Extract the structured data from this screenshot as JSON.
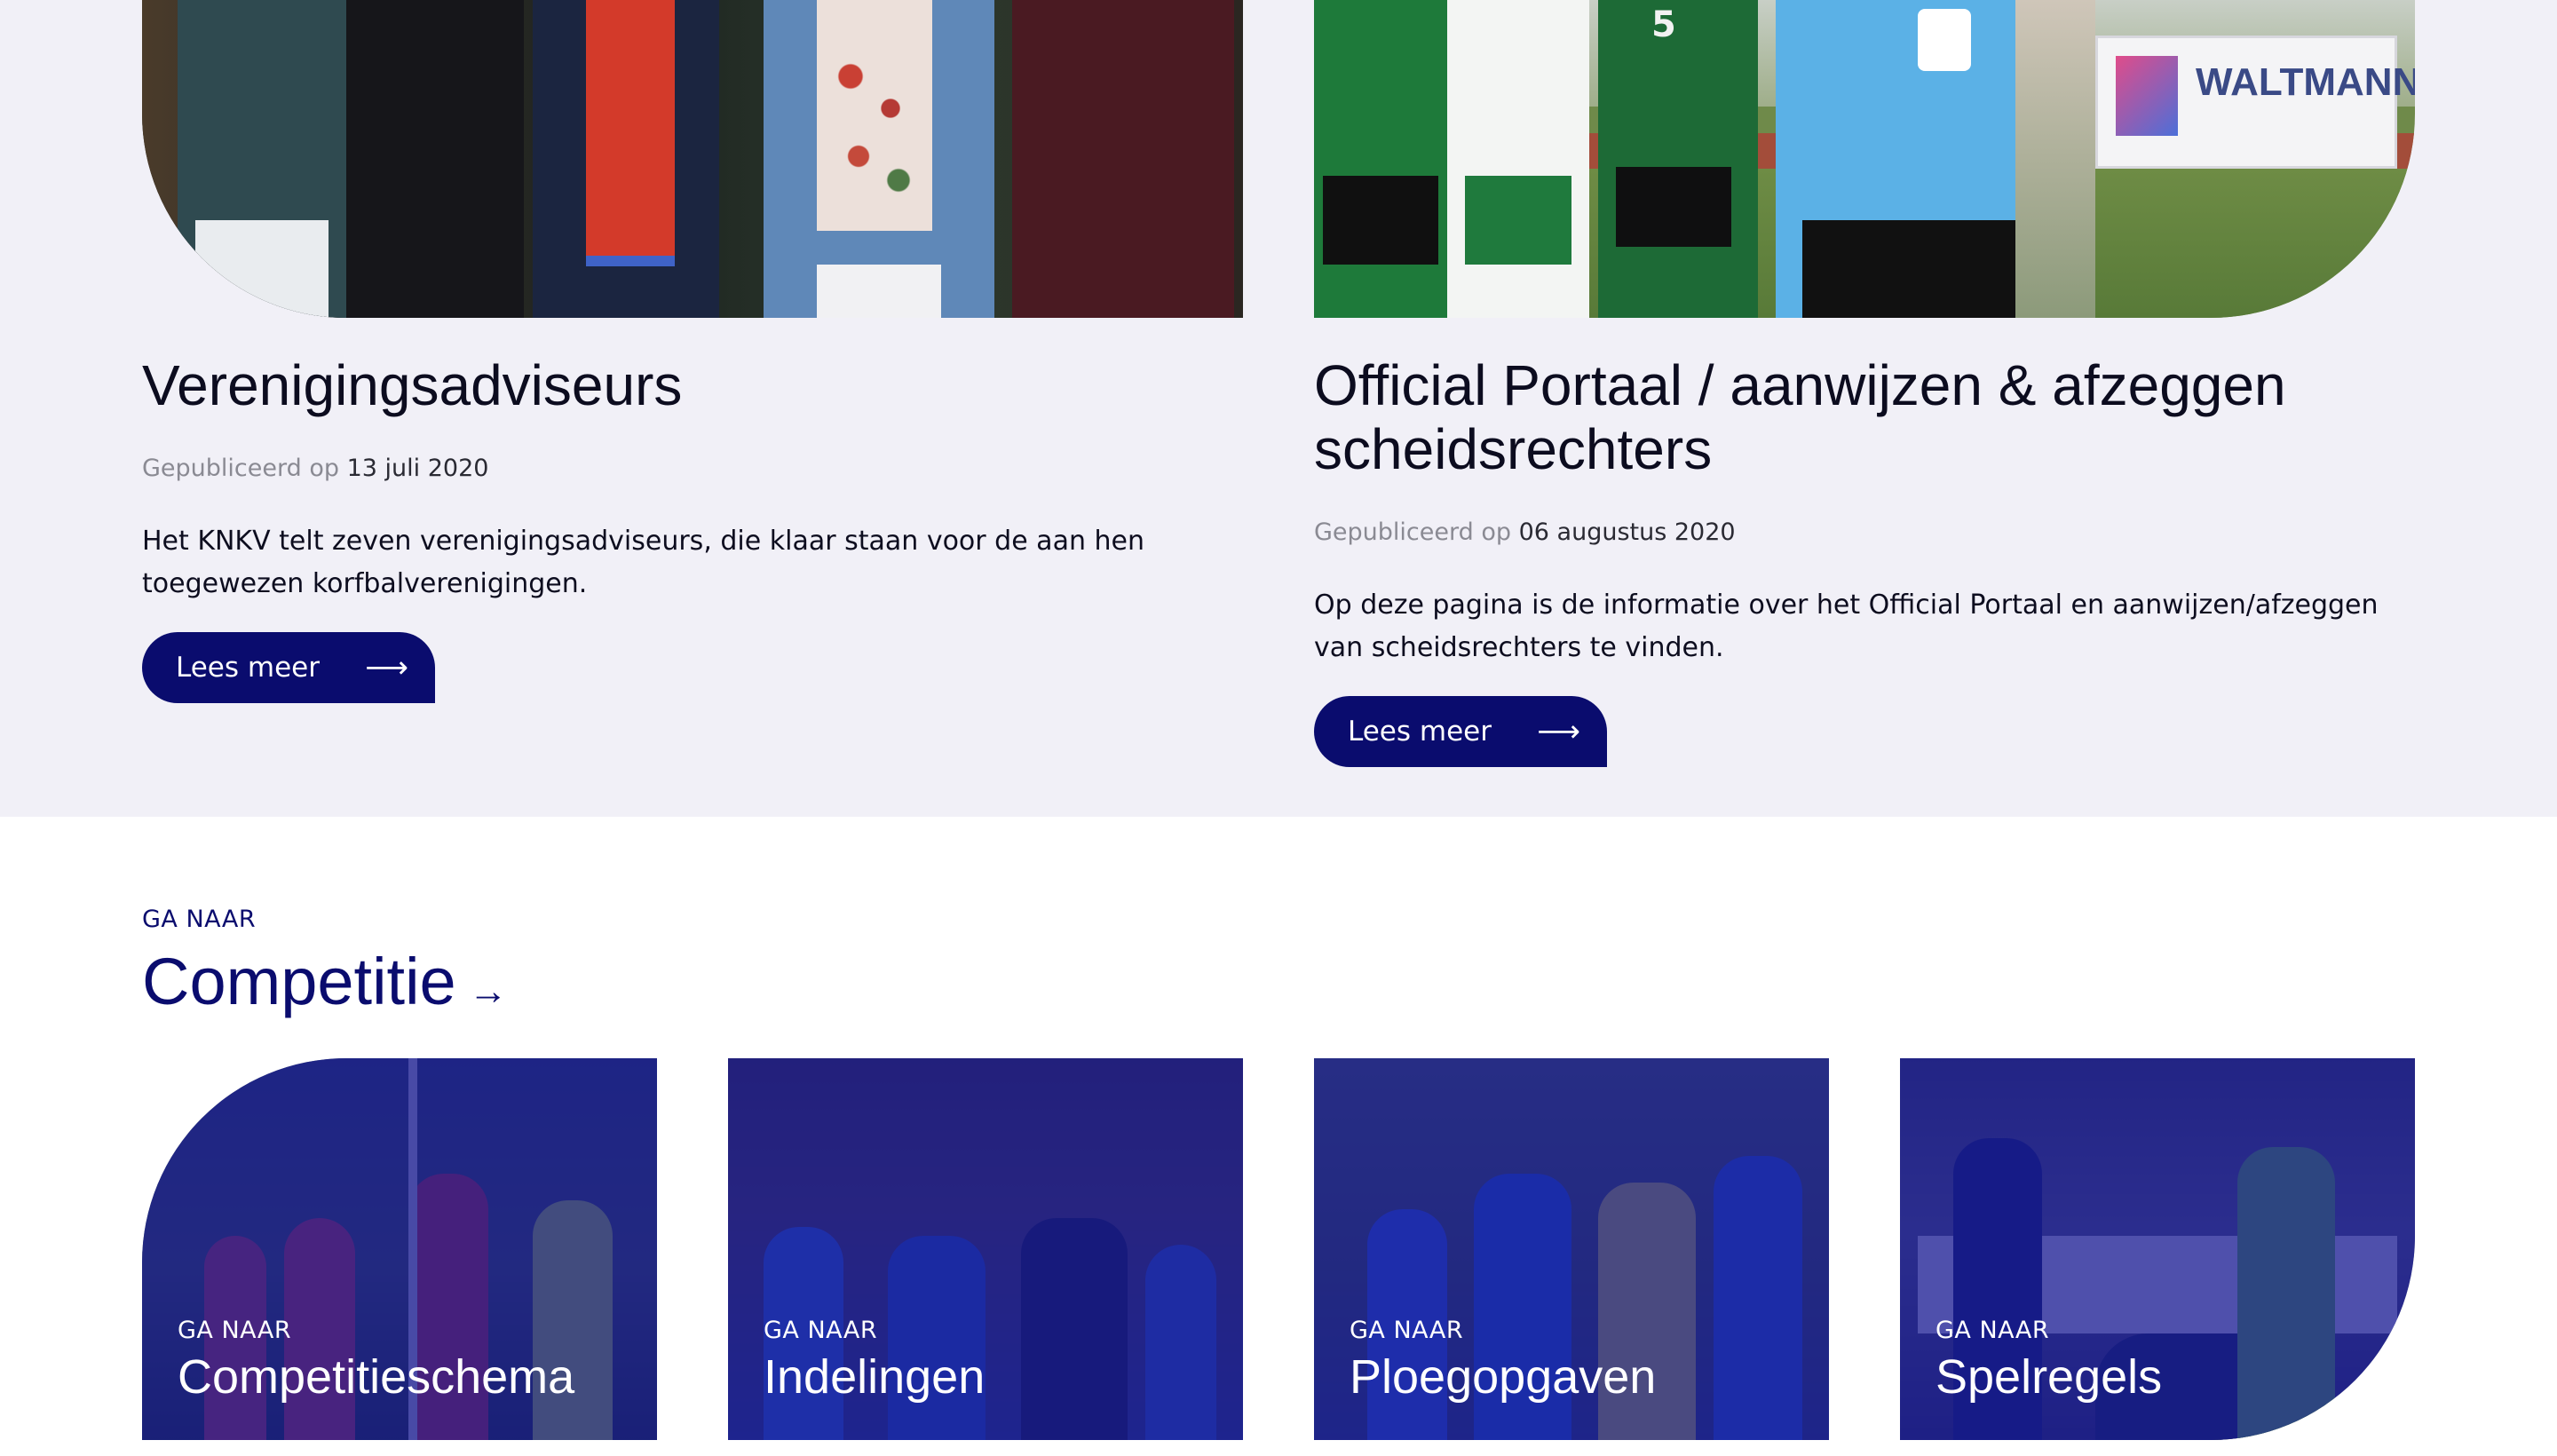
{
  "articles": [
    {
      "title": "Verenigingsadviseurs",
      "published_prefix": "Gepubliceerd op",
      "date": "13 juli 2020",
      "excerpt": "Het KNKV telt zeven verenigingsadviseurs, die klaar staan voor de aan hen toegewezen korfbalverenigingen.",
      "button_label": "Lees meer",
      "button_icon": "arrow-right-icon"
    },
    {
      "title": "Official Portaal / aanwijzen & afzeggen scheidsrechters",
      "published_prefix": "Gepubliceerd op",
      "date": "06 augustus 2020",
      "excerpt": "Op deze pagina is de informatie over het Official Portaal en aanwijzen/afzeggen van scheidsrechters te vinden.",
      "button_label": "Lees meer",
      "button_icon": "arrow-right-icon",
      "photo_banner_text": "WALTMANN",
      "photo_jersey_number": "5"
    }
  ],
  "goto_section": {
    "kicker": "GA NAAR",
    "heading": "Competitie",
    "heading_icon": "arrow-right-icon"
  },
  "tiles": [
    {
      "kicker": "GA NAAR",
      "label": "Competitieschema"
    },
    {
      "kicker": "GA NAAR",
      "label": "Indelingen"
    },
    {
      "kicker": "GA NAAR",
      "label": "Ploegopgaven"
    },
    {
      "kicker": "GA NAAR",
      "label": "Spelregels"
    }
  ],
  "colors": {
    "brand_navy": "#0a0c6e",
    "news_background": "#f1f0f7",
    "tile_overlay": "#14169a"
  }
}
